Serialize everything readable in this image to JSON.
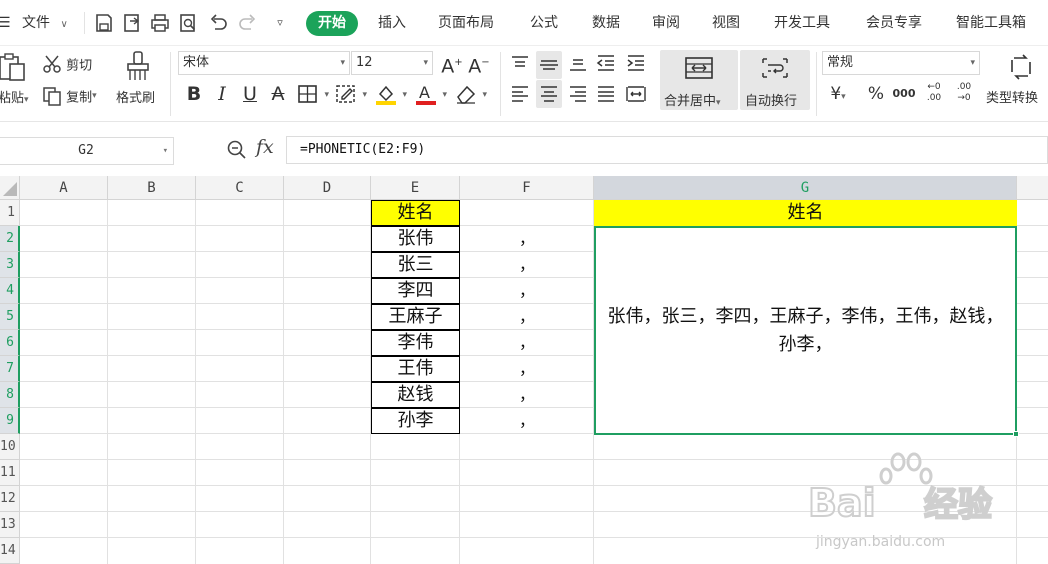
{
  "menubar": {
    "file_label": "文件",
    "tabs": [
      "开始",
      "插入",
      "页面布局",
      "公式",
      "数据",
      "审阅",
      "视图",
      "开发工具",
      "会员专享",
      "智能工具箱"
    ]
  },
  "ribbon": {
    "paste_label": "粘贴",
    "cut_label": "剪切",
    "copy_label": "复制",
    "format_painter_label": "格式刷",
    "font_name": "宋体",
    "font_size": "12",
    "merge_center_label": "合并居中",
    "wrap_text_label": "自动换行",
    "number_format": "常规",
    "type_convert_label": "类型转换"
  },
  "formula_bar": {
    "name_box": "G2",
    "fx_label": "fx",
    "formula": "=PHONETIC(E2:F9)"
  },
  "sheet": {
    "columns": [
      "A",
      "B",
      "C",
      "D",
      "E",
      "F",
      "G"
    ],
    "rows": [
      "1",
      "2",
      "3",
      "4",
      "5",
      "6",
      "7",
      "8",
      "9",
      "10",
      "11",
      "12",
      "13",
      "14"
    ],
    "E": [
      "姓名",
      "张伟",
      "张三",
      "李四",
      "王麻子",
      "李伟",
      "王伟",
      "赵钱",
      "孙李"
    ],
    "F": [
      "",
      "，",
      "，",
      "，",
      "，",
      "，",
      "，",
      "，",
      "，"
    ],
    "G1": "姓名",
    "G2": "张伟，张三，李四，王麻子，李伟，王伟，赵钱，孙李，"
  },
  "colors": {
    "accent": "#1ba35a",
    "selection": "#1f9e61",
    "header_fill": "#ffff00"
  }
}
